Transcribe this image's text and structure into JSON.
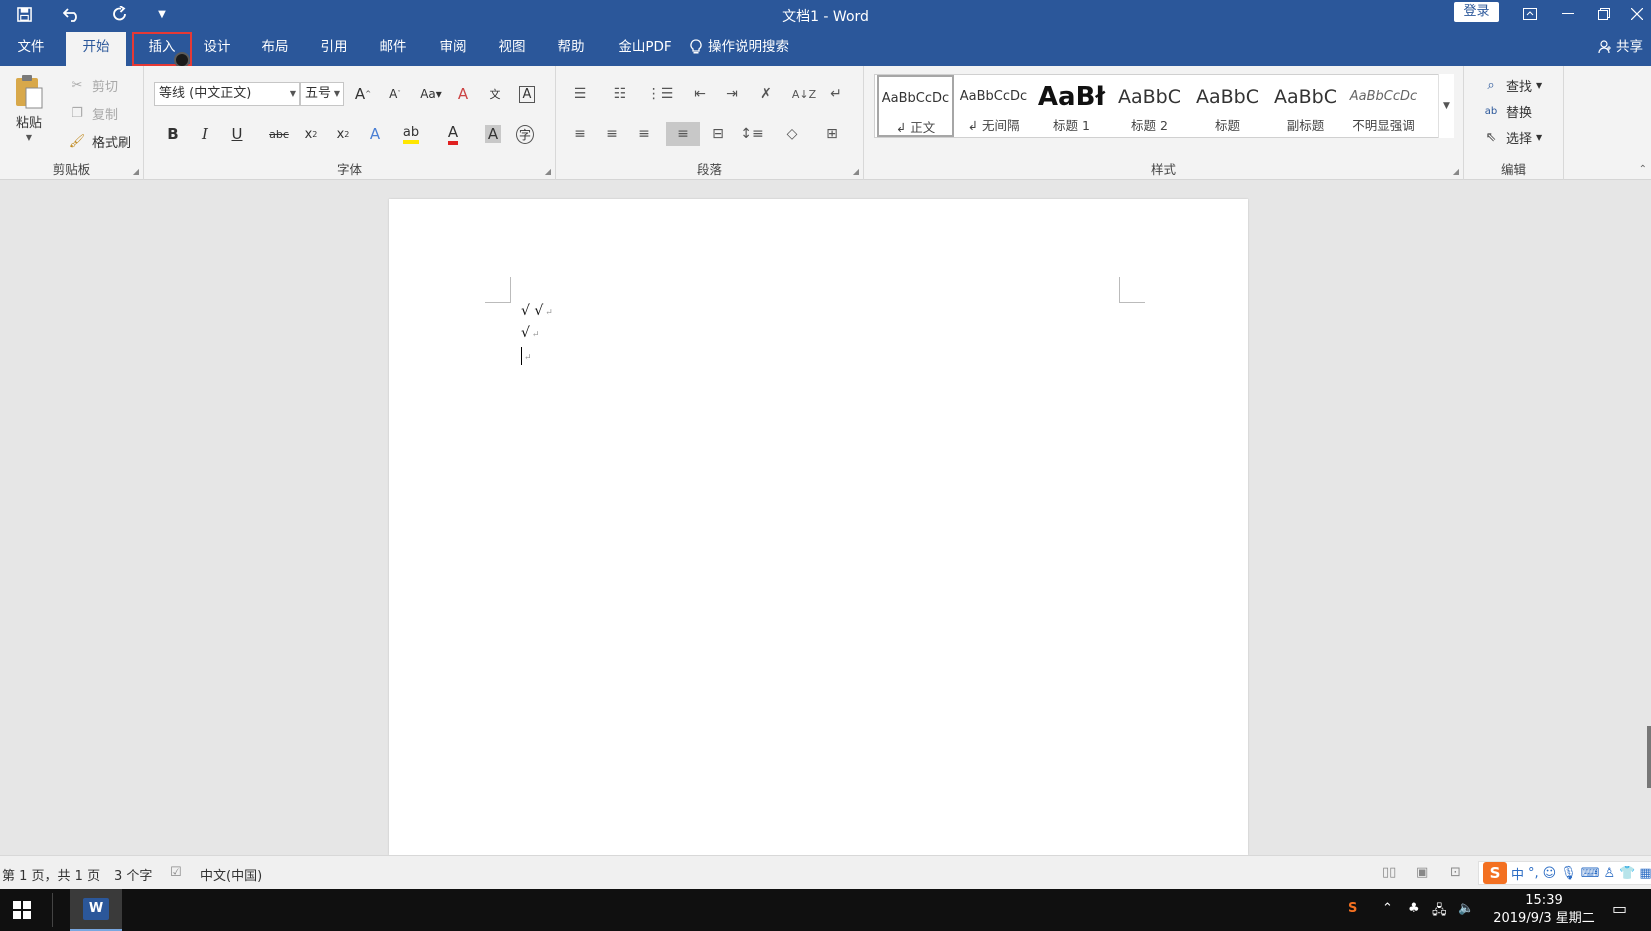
{
  "app": {
    "title": "文档1  -  Word",
    "login_label": "登录"
  },
  "quick_access": {
    "save_icon": "save-icon",
    "undo_icon": "undo-icon",
    "redo_icon": "redo-icon",
    "customize_icon": "chevron-down-icon"
  },
  "tabs": [
    {
      "label": "文件"
    },
    {
      "label": "开始"
    },
    {
      "label": "插入"
    },
    {
      "label": "设计"
    },
    {
      "label": "布局"
    },
    {
      "label": "引用"
    },
    {
      "label": "邮件"
    },
    {
      "label": "审阅"
    },
    {
      "label": "视图"
    },
    {
      "label": "帮助"
    },
    {
      "label": "金山PDF"
    }
  ],
  "tell_me": "操作说明搜索",
  "share": "共享",
  "clipboard": {
    "paste": "粘贴",
    "cut": "剪切",
    "copy": "复制",
    "format_painter": "格式刷",
    "group_label": "剪贴板"
  },
  "font": {
    "font_name": "等线 (中文正文)",
    "font_size": "五号",
    "group_label": "字体"
  },
  "paragraph": {
    "group_label": "段落"
  },
  "styles": {
    "items": [
      {
        "sample": "AaBbCcDc",
        "name": "↲ 正文"
      },
      {
        "sample": "AaBbCcDc",
        "name": "↲ 无间隔"
      },
      {
        "sample": "AaBł",
        "name": "标题 1"
      },
      {
        "sample": "AaBbC",
        "name": "标题 2"
      },
      {
        "sample": "AaBbC",
        "name": "标题"
      },
      {
        "sample": "AaBbC",
        "name": "副标题"
      },
      {
        "sample": "AaBbCcDc",
        "name": "不明显强调"
      }
    ],
    "group_label": "样式"
  },
  "editing": {
    "find": "查找",
    "replace": "替换",
    "select": "选择",
    "group_label": "编辑"
  },
  "document": {
    "lines": [
      "√ √",
      "√"
    ]
  },
  "status": {
    "page": "第 1 页，共 1 页",
    "words": "3 个字",
    "language": "中文(中国)"
  },
  "ime": {
    "mode": "中"
  },
  "clock": {
    "time": "15:39",
    "date": "2019/9/3 星期二"
  }
}
